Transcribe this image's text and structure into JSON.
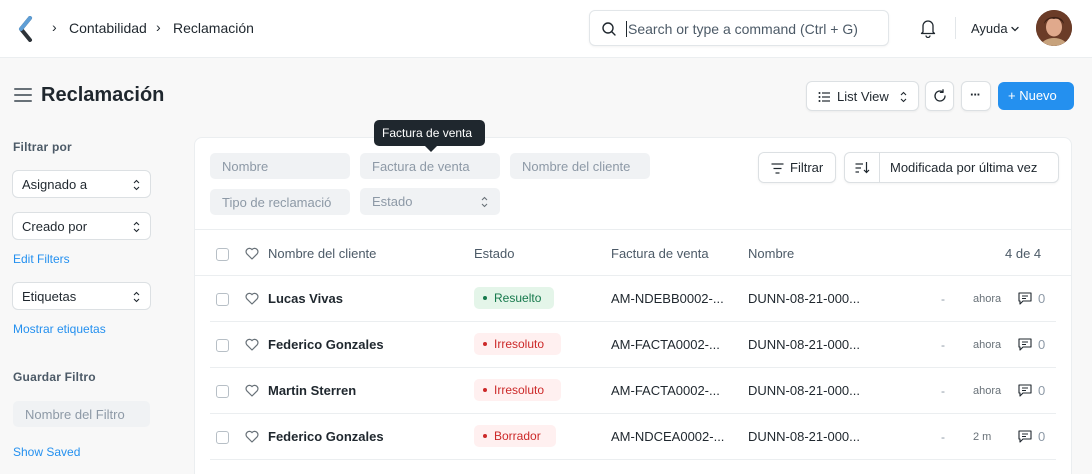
{
  "navbar": {
    "breadcrumbs": [
      "Contabilidad",
      "Reclamación"
    ],
    "search_placeholder": "Search or type a command (Ctrl + G)",
    "help_label": "Ayuda"
  },
  "page": {
    "title": "Reclamación",
    "view_label": "List View",
    "more_label": "···",
    "new_label": "+ Nuevo"
  },
  "sidebar": {
    "filter_heading": "Filtrar por",
    "assigned_label": "Asignado a",
    "created_label": "Creado por",
    "edit_filters": "Edit Filters",
    "tags_label": "Etiquetas",
    "show_tags": "Mostrar etiquetas",
    "save_heading": "Guardar Filtro",
    "filter_name_placeholder": "Nombre del Filtro",
    "show_saved": "Show Saved"
  },
  "filters": {
    "nombre": "Nombre",
    "factura": "Factura de venta",
    "cliente": "Nombre del cliente",
    "tipo": "Tipo de reclamació",
    "estado": "Estado",
    "filter_button": "Filtrar",
    "sort_label": "Modificada por última vez",
    "tooltip": "Factura de venta"
  },
  "table": {
    "headers": {
      "cliente": "Nombre del cliente",
      "estado": "Estado",
      "factura": "Factura de venta",
      "nombre": "Nombre",
      "count": "4 de 4"
    },
    "rows": [
      {
        "cliente": "Lucas Vivas",
        "estado": "Resuelto",
        "factura": "AM-NDEBB0002-...",
        "nombre": "DUNN-08-21-000...",
        "dash": "-",
        "time": "ahora",
        "comments": "0"
      },
      {
        "cliente": "Federico Gonzales",
        "estado": "Irresoluto",
        "factura": "AM-FACTA0002-...",
        "nombre": "DUNN-08-21-000...",
        "dash": "-",
        "time": "ahora",
        "comments": "0"
      },
      {
        "cliente": "Martin Sterren",
        "estado": "Irresoluto",
        "factura": "AM-FACTA0002-...",
        "nombre": "DUNN-08-21-000...",
        "dash": "-",
        "time": "ahora",
        "comments": "0"
      },
      {
        "cliente": "Federico Gonzales",
        "estado": "Borrador",
        "factura": "AM-NDCEA0002-...",
        "nombre": "DUNN-08-21-000...",
        "dash": "-",
        "time": "2 m",
        "comments": "0"
      }
    ]
  },
  "colors": {
    "primary": "#2490ef",
    "resuelto_bg": "#e4f5e9",
    "resuelto_fg": "#16794c",
    "irresoluto_bg": "#fff0f0",
    "irresoluto_fg": "#cc2929",
    "borrador_bg": "#fff0f0",
    "borrador_fg": "#cc2929"
  }
}
